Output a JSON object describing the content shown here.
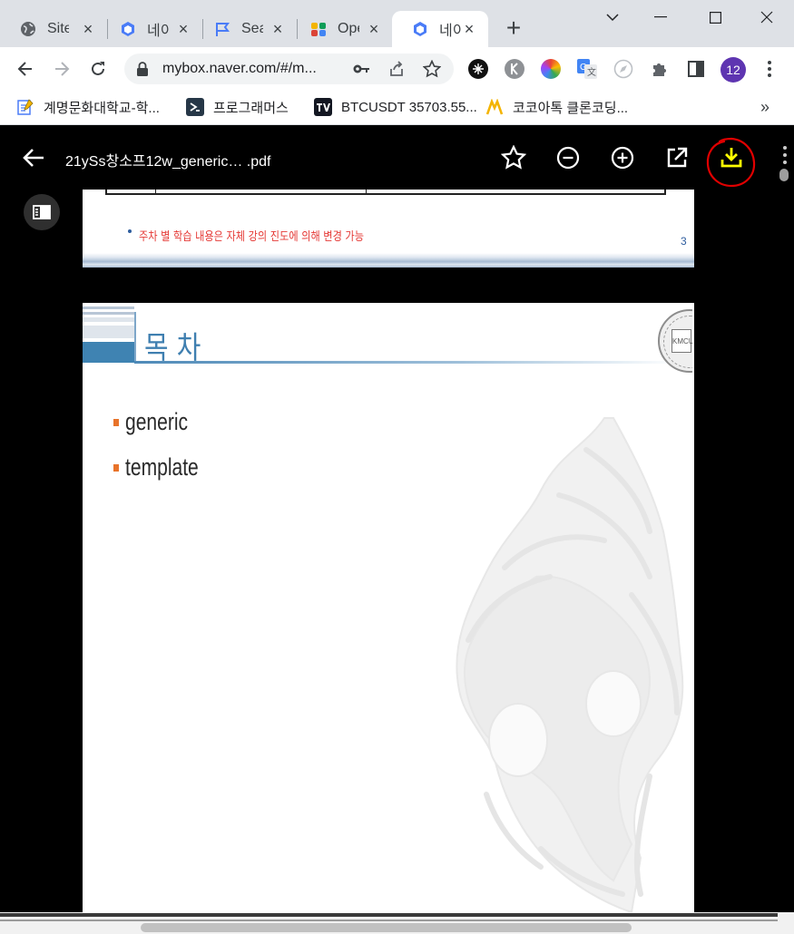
{
  "tabs": [
    {
      "title": "Site",
      "icon": "globe-icon"
    },
    {
      "title": "네이",
      "icon": "mybox-icon"
    },
    {
      "title": "Sea",
      "icon": "flag-icon"
    },
    {
      "title": "Ope",
      "icon": "colorful-logo-icon"
    },
    {
      "title": "네이",
      "icon": "mybox-icon",
      "active": true
    }
  ],
  "address_bar": {
    "url": "mybox.naver.com/#/m..."
  },
  "profile": {
    "label": "12",
    "color": "#5e35b1"
  },
  "bookmarks": [
    {
      "label": "계명문화대학교-학...",
      "icon": "notepad-icon"
    },
    {
      "label": "프로그래머스",
      "icon": "programmers-icon"
    },
    {
      "label": "BTCUSDT 35703.55...",
      "icon": "tradingview-icon"
    },
    {
      "label": "코코아톡 클론코딩...",
      "icon": "nomad-icon"
    }
  ],
  "viewer": {
    "file_name": "21ySs창소프12w_generic… .pdf",
    "highlight_color": "#ffff00",
    "annotation_color": "#e00000"
  },
  "page1": {
    "note": "주차 별 학습 내용은 자체 강의 진도에 의해 변경 가능",
    "page_number": "3"
  },
  "page2": {
    "heading": "목 차",
    "seal_text": "KMCU",
    "bullets": [
      "generic",
      "template"
    ]
  }
}
